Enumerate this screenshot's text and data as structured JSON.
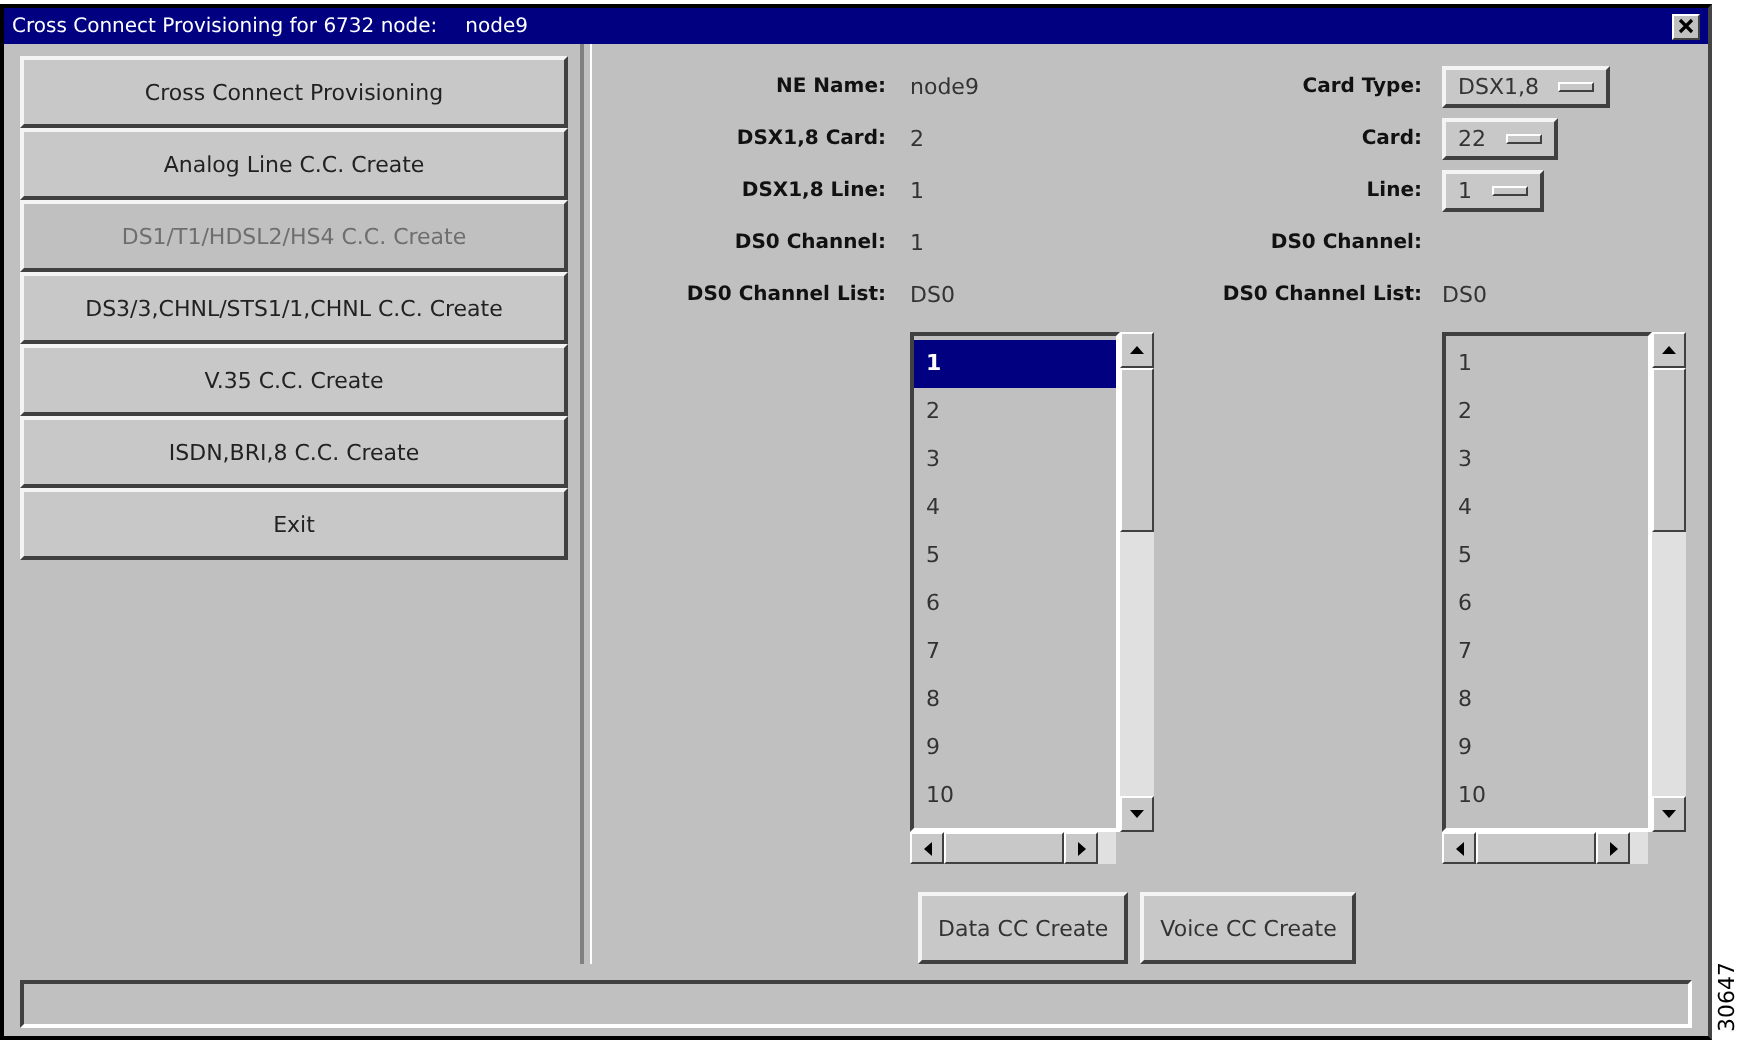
{
  "window": {
    "title": "Cross Connect Provisioning for 6732 node:",
    "node": "node9"
  },
  "nav_buttons": [
    {
      "label": "Cross Connect Provisioning",
      "disabled": false
    },
    {
      "label": "Analog Line C.C. Create",
      "disabled": false
    },
    {
      "label": "DS1/T1/HDSL2/HS4 C.C. Create",
      "disabled": true
    },
    {
      "label": "DS3/3,CHNL/STS1/1,CHNL C.C. Create",
      "disabled": false
    },
    {
      "label": "V.35 C.C. Create",
      "disabled": false
    },
    {
      "label": "ISDN,BRI,8 C.C. Create",
      "disabled": false
    },
    {
      "label": "Exit",
      "disabled": false
    }
  ],
  "panels": [
    {
      "fields": [
        {
          "label": "NE Name:",
          "value": "node9",
          "kind": "text"
        },
        {
          "label": "DSX1,8 Card:",
          "value": "2",
          "kind": "text"
        },
        {
          "label": "DSX1,8 Line:",
          "value": "1",
          "kind": "text"
        },
        {
          "label": "DS0 Channel:",
          "value": "1",
          "kind": "text"
        },
        {
          "label": "DS0 Channel List:",
          "value": "DS0",
          "kind": "text"
        }
      ],
      "channel_list": [
        {
          "label": "1",
          "selected": true
        },
        {
          "label": "2",
          "selected": false
        },
        {
          "label": "3",
          "selected": false
        },
        {
          "label": "4",
          "selected": false
        },
        {
          "label": "5",
          "selected": false
        },
        {
          "label": "6",
          "selected": false
        },
        {
          "label": "7",
          "selected": false
        },
        {
          "label": "8",
          "selected": false
        },
        {
          "label": "9",
          "selected": false
        },
        {
          "label": "10",
          "selected": false
        }
      ]
    },
    {
      "fields": [
        {
          "label": "Card Type:",
          "value": "DSX1,8",
          "kind": "dropdown"
        },
        {
          "label": "Card:",
          "value": "22",
          "kind": "dropdown"
        },
        {
          "label": "Line:",
          "value": "1",
          "kind": "dropdown"
        },
        {
          "label": "DS0 Channel:",
          "kind": "empty"
        },
        {
          "label": "DS0 Channel List:",
          "value": "DS0",
          "kind": "text"
        }
      ],
      "channel_list": [
        {
          "label": "1",
          "selected": false
        },
        {
          "label": "2",
          "selected": false
        },
        {
          "label": "3",
          "selected": false
        },
        {
          "label": "4",
          "selected": false
        },
        {
          "label": "5",
          "selected": false
        },
        {
          "label": "6",
          "selected": false
        },
        {
          "label": "7",
          "selected": false
        },
        {
          "label": "8",
          "selected": false
        },
        {
          "label": "9",
          "selected": false
        },
        {
          "label": "10",
          "selected": false
        }
      ]
    }
  ],
  "action_buttons": [
    "Data CC Create",
    "Voice CC Create"
  ],
  "figure_number": "30647"
}
